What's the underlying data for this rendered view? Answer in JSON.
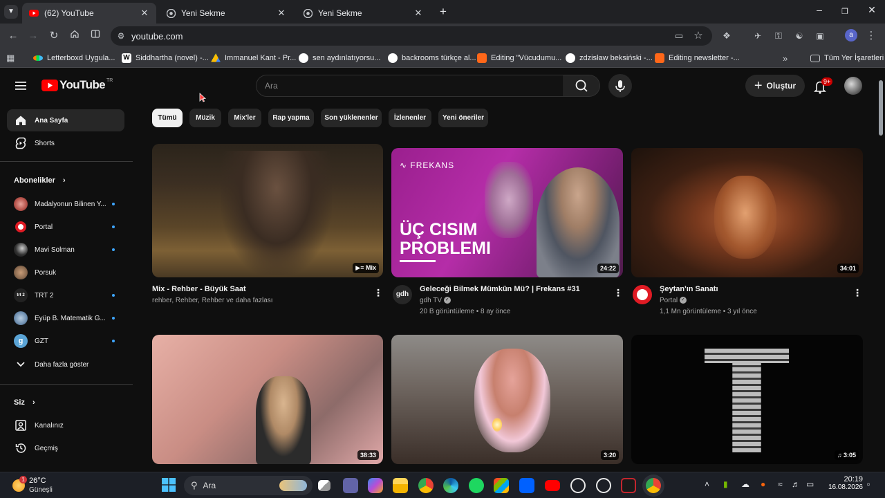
{
  "browser": {
    "tabs": [
      {
        "title": "(62) YouTube",
        "active": true
      },
      {
        "title": "Yeni Sekme",
        "active": false
      },
      {
        "title": "Yeni Sekme",
        "active": false
      }
    ],
    "url": "youtube.com",
    "profile_initial": "a",
    "bookmarks": [
      "Letterboxd Uygula...",
      "Siddhartha (novel) -...",
      "Immanuel Kant - Pr...",
      "sen aydınlatıyorsu...",
      "backrooms türkçe al...",
      "Editing \"Vücudumu...",
      "zdzisław beksiński -...",
      "Editing newsletter -..."
    ],
    "all_bookmarks": "Tüm Yer İşaretleri"
  },
  "youtube": {
    "logo_text": "YouTube",
    "logo_region": "TR",
    "search_placeholder": "Ara",
    "create_label": "Oluştur",
    "notification_badge": "9+",
    "chips": [
      "Tümü",
      "Müzik",
      "Mix'ler",
      "Rap yapma",
      "Son yüklenenler",
      "İzlenenler",
      "Yeni öneriler"
    ],
    "sidebar": {
      "main": [
        "Ana Sayfa",
        "Shorts"
      ],
      "subscriptions_header": "Abonelikler",
      "subscriptions": [
        {
          "name": "Madalyonun Bilinen Y...",
          "color": "#b5524a"
        },
        {
          "name": "Portal",
          "color": "#e01b24"
        },
        {
          "name": "Mavi Solman",
          "color": "#333333"
        },
        {
          "name": "Porsuk",
          "color": "#8a6a50"
        },
        {
          "name": "TRT 2",
          "color": "#222222"
        },
        {
          "name": "Eyüp B. Matematik G...",
          "color": "#6f8fb0"
        },
        {
          "name": "GZT",
          "color": "#5aa4d6"
        }
      ],
      "show_more": "Daha fazla göster",
      "you_header": "Siz",
      "you_items": [
        "Kanalınız",
        "Geçmiş"
      ]
    },
    "videos": [
      {
        "title": "Mix - Rehber - Büyük Saat",
        "channel": "rehber, Rehber, Rehber ve daha fazlası",
        "stats": "",
        "badge": "Mix"
      },
      {
        "title": "Geleceği Bilmek Mümkün Mü? | Frekans #31",
        "channel": "gdh TV",
        "stats": "20 B görüntüleme • 8 ay önce",
        "badge": "24:22",
        "thumb_text_1": "FREKANS",
        "thumb_text_2": "ÜÇ CISIM",
        "thumb_text_3": "PROBLEMI",
        "avatar_text": "gdh"
      },
      {
        "title": "Şeytan'ın Sanatı",
        "channel": "Portal",
        "stats": "1,1 Mn görüntüleme • 3 yıl önce",
        "badge": "34:01"
      },
      {
        "title": "",
        "channel": "",
        "stats": "",
        "badge": "38:33"
      },
      {
        "title": "",
        "channel": "",
        "stats": "",
        "badge": "3:20"
      },
      {
        "title": "",
        "channel": "",
        "stats": "",
        "badge": "3:05"
      }
    ]
  },
  "taskbar": {
    "weather_temp": "26°C",
    "weather_desc": "Güneşli",
    "weather_badge": "1",
    "search_label": "Ara",
    "time": "20:19",
    "date": "16.08.2026"
  }
}
